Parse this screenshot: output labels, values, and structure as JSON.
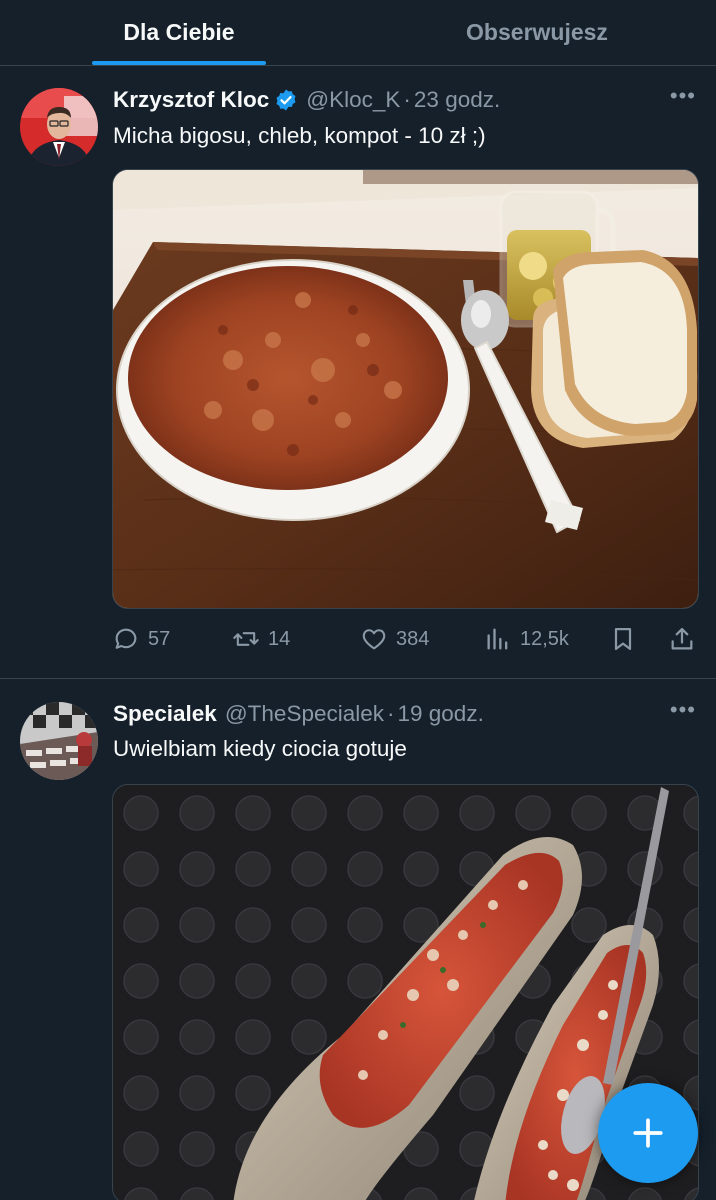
{
  "tabs": [
    {
      "label": "Dla Ciebie",
      "active": true
    },
    {
      "label": "Obserwujesz",
      "active": false
    }
  ],
  "tweets": [
    {
      "name": "Krzysztof Kloc",
      "verified": true,
      "handle": "@Kloc_K",
      "separator": "·",
      "time": "23 godz.",
      "text": "Micha bigosu, chleb, kompot - 10 zł ;)",
      "image": "photo of a bowl of bigos stew with bread, spoon and a glass of compote on a wooden tray",
      "actions": {
        "replies": "57",
        "retweets": "14",
        "likes": "384",
        "views": "12,5k"
      }
    },
    {
      "name": "Specialek",
      "verified": false,
      "handle": "@TheSpecialek",
      "separator": "·",
      "time": "19 godz.",
      "text": "Uwielbiam kiedy ciocia gotuje",
      "image": "photo of soup served in two slipper shoes with a spoon on dark dotted background"
    }
  ],
  "more_label": "•••",
  "icons": {
    "verified": "verified-badge-icon",
    "reply": "reply-icon",
    "retweet": "retweet-icon",
    "like": "heart-icon",
    "views": "views-icon",
    "bookmark": "bookmark-icon",
    "share": "share-icon",
    "compose": "plus-icon"
  },
  "colors": {
    "background": "#15202b",
    "accent": "#1d9bf0",
    "muted": "#8b98a5",
    "divider": "#38444d"
  }
}
